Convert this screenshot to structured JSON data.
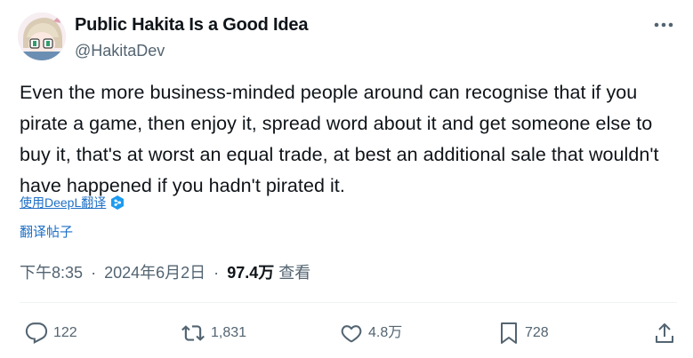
{
  "author": {
    "display_name": "Public Hakita Is a Good Idea",
    "handle": "@HakitaDev"
  },
  "tweet": {
    "text": "Even the more business-minded people around can recognise that if you pirate a game, then enjoy it, spread word about it and get someone else to buy it, that's at worst an equal trade, at best an additional sale that wouldn't have happened if you hadn't pirated it."
  },
  "translate": {
    "deepl_label": "使用DeepL翻译",
    "post_label": "翻译帖子"
  },
  "meta": {
    "time": "下午8:35",
    "date": "2024年6月2日",
    "views_count": "97.4万",
    "views_label": "查看",
    "separator": "·"
  },
  "actions": {
    "replies": "122",
    "reposts": "1,831",
    "likes": "4.8万",
    "bookmarks": "728"
  },
  "colors": {
    "text": "#0f1419",
    "secondary": "#536471",
    "link": "#1d6fc6",
    "deepl_badge": "#1d9bf0"
  },
  "icons": {
    "more": "more-horizontal-icon",
    "reply": "reply-icon",
    "repost": "repost-icon",
    "like": "heart-icon",
    "bookmark": "bookmark-icon",
    "share": "share-icon",
    "deepl": "deepl-badge-icon"
  }
}
